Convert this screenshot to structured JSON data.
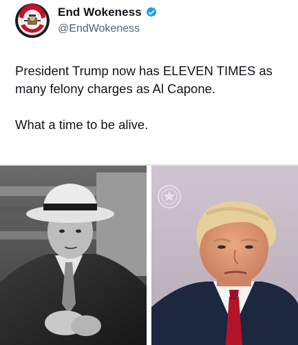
{
  "tweet": {
    "author": {
      "display_name": "End Wokeness",
      "handle": "@EndWokeness",
      "verified": true,
      "verified_color": "#1d9bf0",
      "avatar_icon": "support-our-farmers-logo-icon"
    },
    "text_line_1": "President Trump now has ELEVEN TIMES as many felony charges as Al Capone.",
    "text_line_2": "What a time to be alive.",
    "media": [
      {
        "name": "al-capone-photo",
        "style": "black-and-white portrait"
      },
      {
        "name": "trump-mugshot-photo",
        "style": "color mugshot with seal"
      }
    ]
  }
}
